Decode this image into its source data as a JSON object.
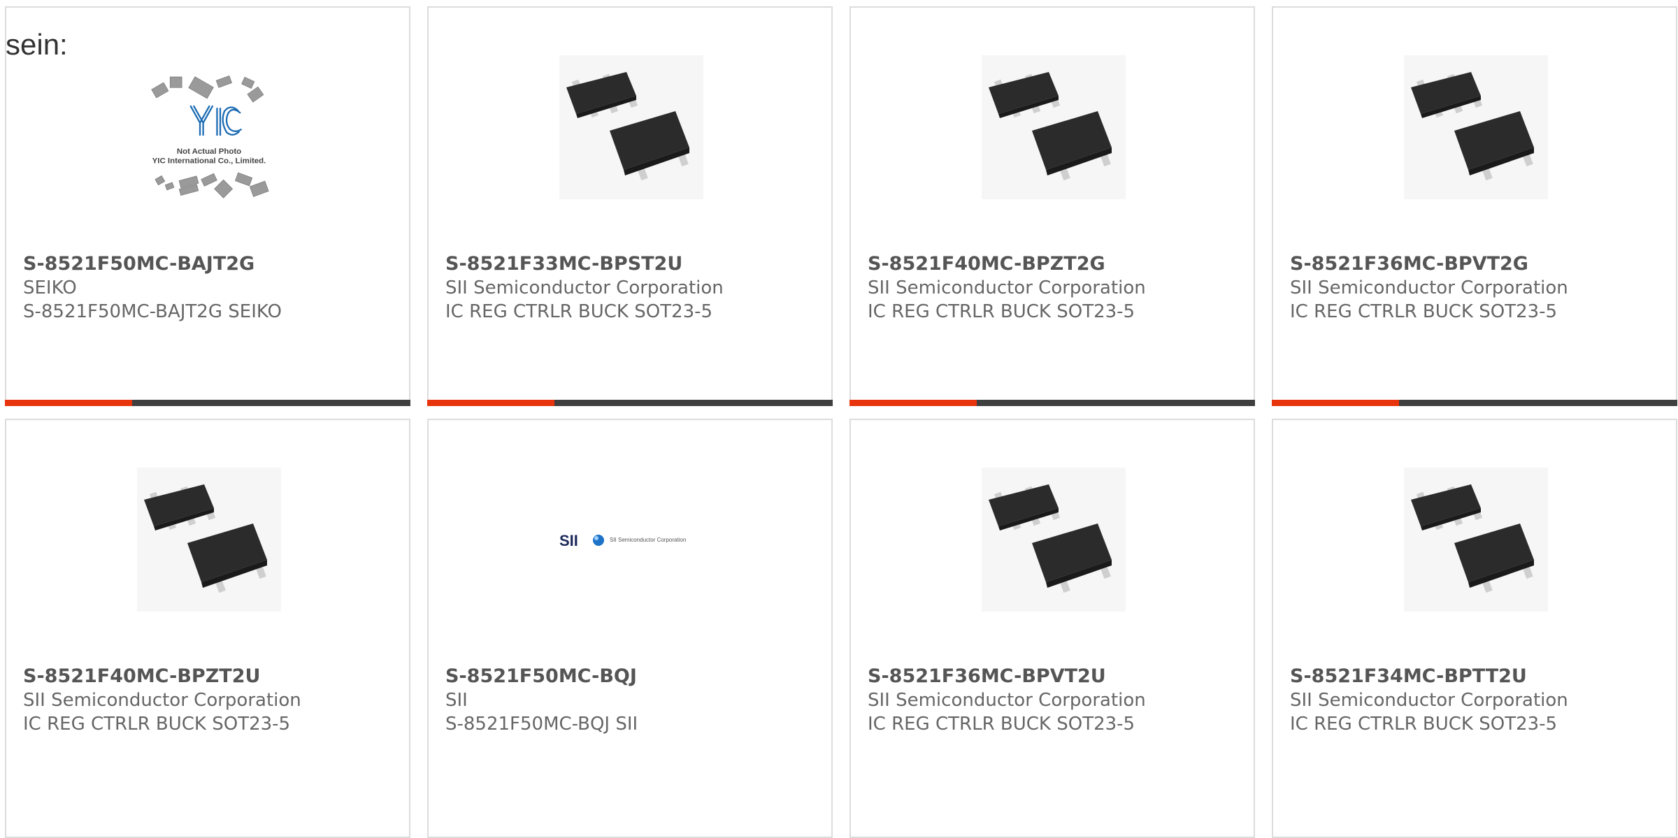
{
  "header": {
    "text": "sein:"
  },
  "colors": {
    "accent": "#e8340d",
    "bar": "#3f3f3f",
    "border": "#dcdcdc"
  },
  "cards": [
    {
      "part_number": "S-8521F50MC-BAJT2G",
      "maker": "SEIKO",
      "description": "S-8521F50MC-BAJT2G SEIKO",
      "image": "not-actual-photo-placeholder",
      "image_text": {
        "line1": "Not Actual Photo",
        "line2": "YIC International Co., Limited.",
        "logo": "YIC"
      }
    },
    {
      "part_number": "S-8521F33MC-BPST2U",
      "maker": "SII Semiconductor Corporation",
      "description": "IC REG CTRLR BUCK SOT23-5",
      "image": "sot23-chip-photo"
    },
    {
      "part_number": "S-8521F40MC-BPZT2G",
      "maker": "SII Semiconductor Corporation",
      "description": "IC REG CTRLR BUCK SOT23-5",
      "image": "sot23-chip-photo"
    },
    {
      "part_number": "S-8521F36MC-BPVT2G",
      "maker": "SII Semiconductor Corporation",
      "description": "IC REG CTRLR BUCK SOT23-5",
      "image": "sot23-chip-photo"
    },
    {
      "part_number": "S-8521F40MC-BPZT2U",
      "maker": "SII Semiconductor Corporation",
      "description": "IC REG CTRLR BUCK SOT23-5",
      "image": "sot23-chip-photo"
    },
    {
      "part_number": "S-8521F50MC-BQJ",
      "maker": "SII",
      "description": "S-8521F50MC-BQJ SII",
      "image": "sii-logo",
      "image_text": {
        "logo": "SII",
        "tagline": "SII Semiconductor Corporation"
      }
    },
    {
      "part_number": "S-8521F36MC-BPVT2U",
      "maker": "SII Semiconductor Corporation",
      "description": "IC REG CTRLR BUCK SOT23-5",
      "image": "sot23-chip-photo"
    },
    {
      "part_number": "S-8521F34MC-BPTT2U",
      "maker": "SII Semiconductor Corporation",
      "description": "IC REG CTRLR BUCK SOT23-5",
      "image": "sot23-chip-photo"
    }
  ]
}
